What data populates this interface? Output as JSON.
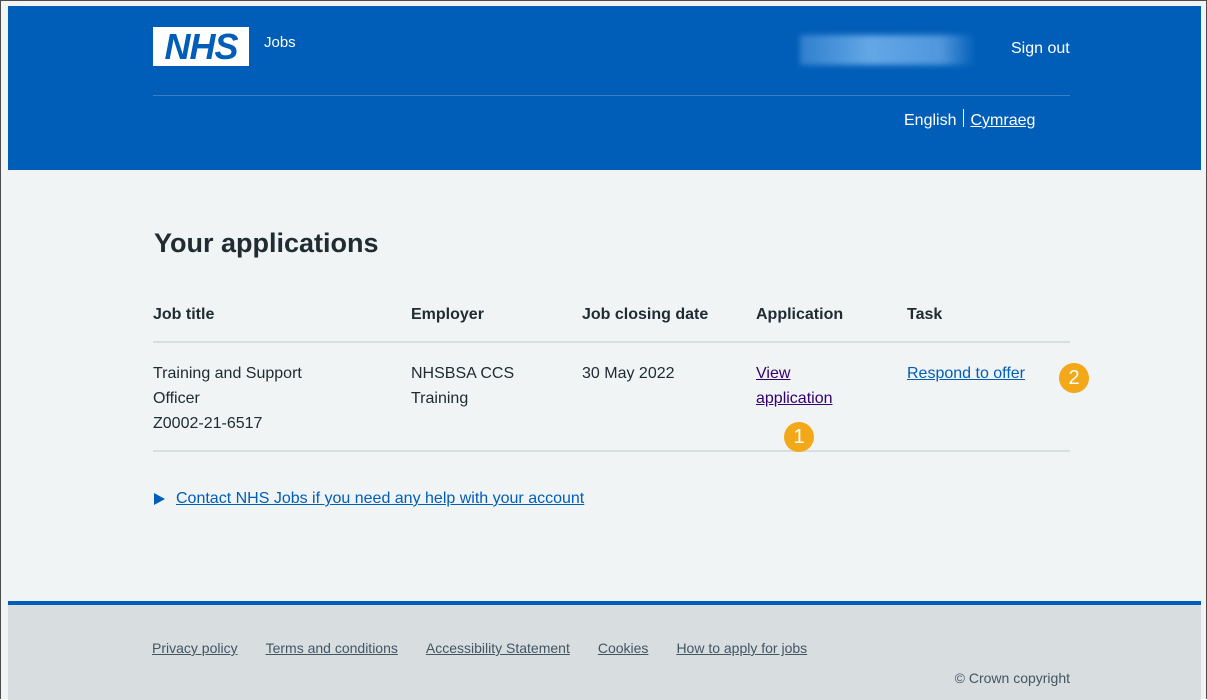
{
  "header": {
    "logo_text": "NHS",
    "service_name": "Jobs",
    "sign_out_label": "Sign out",
    "language": {
      "english": "English",
      "welsh": "Cymraeg"
    }
  },
  "main": {
    "title": "Your applications",
    "table": {
      "headers": [
        "Job title",
        "Employer",
        "Job closing date",
        "Application",
        "Task"
      ],
      "rows": [
        {
          "job_title": "Training and Support Officer",
          "job_ref": "Z0002-21-6517",
          "employer": "NHSBSA CCS Training",
          "closing_date": "30 May 2022",
          "application_link": "View application",
          "task_link": "Respond to offer"
        }
      ]
    },
    "callouts": [
      "1",
      "2"
    ],
    "help_details": "Contact NHS Jobs if you need any help with your account"
  },
  "footer": {
    "links": [
      "Privacy policy",
      "Terms and conditions",
      "Accessibility Statement",
      "Cookies",
      "How to apply for jobs"
    ],
    "copyright": "© Crown copyright"
  },
  "colors": {
    "nhs_blue": "#005eb8",
    "page_bg": "#f0f4f5",
    "footer_bg": "#d8dde0",
    "callout": "#f3a81a",
    "visited_link": "#330072"
  }
}
